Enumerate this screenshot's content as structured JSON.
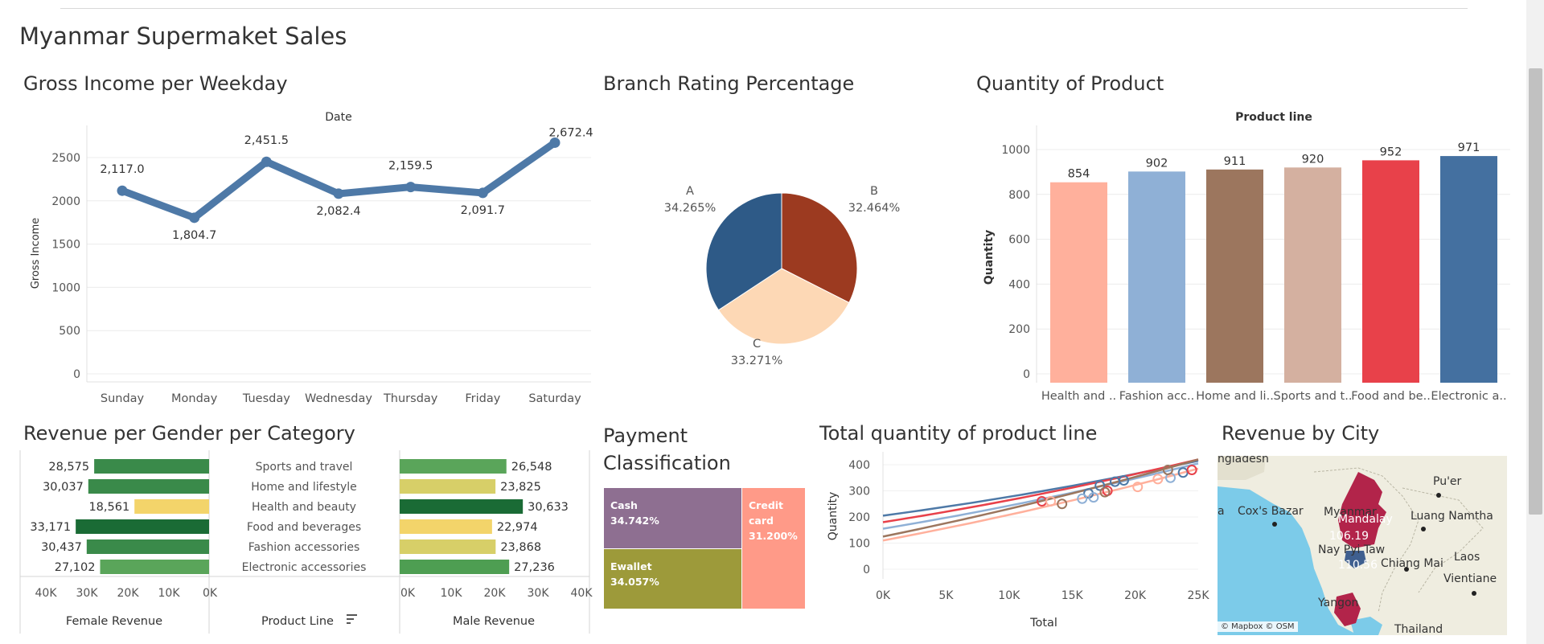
{
  "dashboard_title": "Myanmar Supermaket Sales",
  "sheets": {
    "gross": "Gross Income per Weekday",
    "branch": "Branch Rating Percentage",
    "quantity": "Quantity of Product",
    "gender": "Revenue per Gender per Category",
    "payment": "Payment Classification",
    "total_qty": "Total quantity of product line",
    "city": "Revenue by City"
  },
  "chart_data": [
    {
      "id": "gross-income",
      "type": "line",
      "title": "Date",
      "ylabel": "Gross Income",
      "categories": [
        "Sunday",
        "Monday",
        "Tuesday",
        "Wednesday",
        "Thursday",
        "Friday",
        "Saturday"
      ],
      "values": [
        2117.0,
        1804.7,
        2451.5,
        2082.4,
        2159.5,
        2091.7,
        2672.4
      ],
      "value_labels": [
        "2,117.0",
        "1,804.7",
        "2,451.5",
        "2,082.4",
        "2,159.5",
        "2,091.7",
        "2,672.4"
      ],
      "yticks": [
        "0",
        "500",
        "1000",
        "1500",
        "2000",
        "2500"
      ],
      "ylim": [
        0,
        2800
      ],
      "color": "#4e79a7"
    },
    {
      "id": "branch-rating",
      "type": "pie",
      "slices": [
        {
          "name": "A",
          "value": 34.265,
          "label": "34.265%",
          "color": "#2e5a87"
        },
        {
          "name": "B",
          "value": 32.464,
          "label": "32.464%",
          "color": "#9c3a20"
        },
        {
          "name": "C",
          "value": 33.271,
          "label": "33.271%",
          "color": "#fdd8b5"
        }
      ]
    },
    {
      "id": "quantity-product",
      "type": "bar",
      "title": "Product line",
      "ylabel": "Quantity",
      "categories": [
        "Health and ..",
        "Fashion acc..",
        "Home and li..",
        "Sports and t..",
        "Food and be..",
        "Electronic a.."
      ],
      "values": [
        854,
        902,
        911,
        920,
        952,
        971
      ],
      "colors": [
        "#ffb09c",
        "#8fb0d6",
        "#9c765e",
        "#d4b0a0",
        "#e8414a",
        "#4470a0"
      ],
      "yticks": [
        "0",
        "200",
        "400",
        "600",
        "800",
        "1000"
      ],
      "ylim": [
        0,
        1100
      ]
    },
    {
      "id": "revenue-gender",
      "type": "bar",
      "categories": [
        "Sports and travel",
        "Home and lifestyle",
        "Health and beauty",
        "Food and beverages",
        "Fashion accessories",
        "Electronic accessories"
      ],
      "series": [
        {
          "name": "Female Revenue",
          "values": [
            28575,
            30037,
            18561,
            33171,
            30437,
            27102
          ],
          "labels": [
            "28,575",
            "30,037",
            "18,561",
            "33,171",
            "30,437",
            "27,102"
          ],
          "colors": [
            "#3a8a4a",
            "#3a8a4a",
            "#f3d46a",
            "#1a6b35",
            "#3a8a4a",
            "#5aa55a"
          ]
        },
        {
          "name": "Male Revenue",
          "values": [
            26548,
            23825,
            30633,
            22974,
            23868,
            27236
          ],
          "labels": [
            "26,548",
            "23,825",
            "30,633",
            "22,974",
            "23,868",
            "27,236"
          ],
          "colors": [
            "#5aa55a",
            "#d7cf68",
            "#1a6b35",
            "#f3d46a",
            "#d7cf68",
            "#4e9e52"
          ]
        }
      ],
      "female_ticks": [
        "40K",
        "30K",
        "20K",
        "10K",
        "0K"
      ],
      "male_ticks": [
        "0K",
        "10K",
        "20K",
        "30K",
        "40K"
      ],
      "xlim": [
        0,
        45000
      ],
      "center_header": "Product Line"
    },
    {
      "id": "payment",
      "type": "treemap",
      "cells": [
        {
          "name": "Cash",
          "label": "34.742%",
          "value": 34.742,
          "color": "#8e6f91"
        },
        {
          "name": "Ewallet",
          "label": "34.057%",
          "value": 34.057,
          "color": "#9d9a3a"
        },
        {
          "name": "Credit card",
          "label": "31.200%",
          "value": 31.2,
          "color": "#ff9a88"
        }
      ]
    },
    {
      "id": "total-quantity",
      "type": "scatter",
      "xlabel": "Total",
      "ylabel": "Quantity",
      "xticks": [
        "0K",
        "5K",
        "10K",
        "15K",
        "20K",
        "25K"
      ],
      "yticks": [
        "0",
        "100",
        "200",
        "300",
        "400"
      ],
      "xlim": [
        0,
        25000
      ],
      "ylim": [
        0,
        420
      ],
      "series": [
        {
          "color": "#4e79a7",
          "points": [
            [
              16300,
              290
            ],
            [
              17200,
              320
            ],
            [
              18400,
              335
            ],
            [
              19100,
              340
            ],
            [
              23800,
              370
            ]
          ],
          "trend": [
            [
              0,
              205
            ],
            [
              25000,
              415
            ]
          ]
        },
        {
          "color": "#e8414a",
          "points": [
            [
              12600,
              260
            ],
            [
              17800,
              300
            ],
            [
              24500,
              380
            ]
          ],
          "trend": [
            [
              0,
              180
            ],
            [
              25000,
              420
            ]
          ]
        },
        {
          "color": "#8fb0d6",
          "points": [
            [
              15800,
              270
            ],
            [
              16700,
              275
            ],
            [
              22800,
              350
            ]
          ],
          "trend": [
            [
              0,
              155
            ],
            [
              25000,
              405
            ]
          ]
        },
        {
          "color": "#9c765e",
          "points": [
            [
              14200,
              250
            ],
            [
              17600,
              295
            ],
            [
              22600,
              380
            ]
          ],
          "trend": [
            [
              0,
              125
            ],
            [
              25000,
              420
            ]
          ]
        },
        {
          "color": "#ffb09c",
          "points": [
            [
              13300,
              260
            ],
            [
              20200,
              315
            ],
            [
              21800,
              345
            ]
          ],
          "trend": [
            [
              0,
              110
            ],
            [
              25000,
              385
            ]
          ]
        }
      ]
    }
  ],
  "map": {
    "places": [
      {
        "name": "Bangladesh",
        "text": "ngladesh"
      },
      {
        "name": "Cox's Bazar",
        "text": "Cox's Bazar"
      },
      {
        "name": "Pu'er",
        "text": "Pu'er"
      },
      {
        "name": "Luang Namtha",
        "text": "Luang Namtha"
      },
      {
        "name": "Myanmar",
        "text": "Myanmar"
      },
      {
        "name": "Mandalay",
        "text": "Mandalay"
      },
      {
        "name": "Nay Pyi Taw",
        "text": "Nay Pyi Taw"
      },
      {
        "name": "Chiang Mai",
        "text": "Chiang Mai"
      },
      {
        "name": "Laos",
        "text": "Laos"
      },
      {
        "name": "Vientiane",
        "text": "Vientiane"
      },
      {
        "name": "Yangon",
        "text": "Yangon"
      },
      {
        "name": "Thailand",
        "text": "Thailand"
      },
      {
        "name": "edge-a",
        "text": "a"
      }
    ],
    "values": {
      "mandalay": "106.19",
      "naypyitaw": "110.56"
    },
    "attribution": "© Mapbox  © OSM",
    "colors": {
      "land": "#efede0",
      "water": "#7ccbe9",
      "region": "#b2244a",
      "region2": "#3f5f8f"
    }
  }
}
